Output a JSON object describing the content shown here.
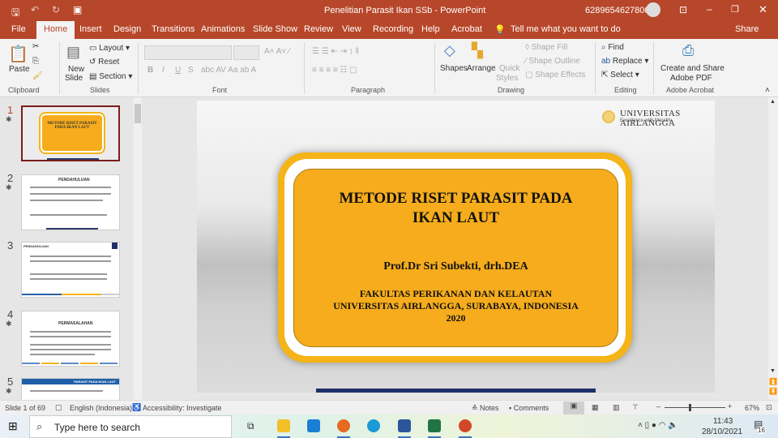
{
  "titlebar": {
    "title": "Penelitian Parasit Ikan SSb  -  PowerPoint",
    "account": "6289654627800"
  },
  "tabs": [
    "File",
    "Home",
    "Insert",
    "Design",
    "Transitions",
    "Animations",
    "Slide Show",
    "Review",
    "View",
    "Recording",
    "Help",
    "Acrobat"
  ],
  "tell_me": "Tell me what you want to do",
  "share": "Share",
  "ribbon": {
    "clipboard": {
      "paste": "Paste",
      "label": "Clipboard"
    },
    "slides": {
      "new_slide": "New",
      "new_slide2": "Slide",
      "layout": "Layout",
      "reset": "Reset",
      "section": "Section",
      "label": "Slides"
    },
    "font": {
      "label": "Font",
      "bold": "B",
      "italic": "I",
      "underline": "U",
      "strike": "S"
    },
    "paragraph": {
      "label": "Paragraph"
    },
    "drawing": {
      "shapes": "Shapes",
      "arrange": "Arrange",
      "quick": "Quick",
      "styles": "Styles",
      "fill": "Shape Fill",
      "outline": "Shape Outline",
      "effects": "Shape Effects",
      "label": "Drawing"
    },
    "editing": {
      "find": "Find",
      "replace": "Replace",
      "select": "Select",
      "label": "Editing"
    },
    "acrobat": {
      "create": "Create and Share",
      "pdf": "Adobe PDF",
      "label": "Adobe Acrobat"
    }
  },
  "thumbnails": [
    {
      "num": "1",
      "title": "METODE RISET PARASIT PADA IKAN LAUT"
    },
    {
      "num": "2",
      "title": "PENDAHULUAN"
    },
    {
      "num": "3",
      "title": "PENDAHULUAN"
    },
    {
      "num": "4",
      "title": "PERMASALAHAN"
    },
    {
      "num": "5",
      "title": "PARASIT PADA IKAN LAUT"
    }
  ],
  "slide": {
    "logo_name": "UNIVERSITAS AIRLANGGA",
    "logo_tagline": "Excellence with Morality",
    "title1": "METODE RISET PARASIT PADA",
    "title2": "IKAN LAUT",
    "author": "Prof.Dr Sri Subekti, drh.DEA",
    "inst1": "FAKULTAS PERIKANAN DAN KELAUTAN",
    "inst2": "UNIVERSITAS AIRLANGGA, SURABAYA, INDONESIA",
    "year": "2020"
  },
  "status": {
    "slide": "Slide 1 of 69",
    "lang": "English (Indonesia)",
    "access": "Accessibility: Investigate",
    "notes": "Notes",
    "comments": "Comments",
    "zoom": "67%"
  },
  "taskbar": {
    "search": "Type here to search",
    "time": "11:43",
    "date": "28/10/2021",
    "notif": "16"
  },
  "colors": {
    "accent": "#b7472a",
    "slide_orange": "#f6ac1c",
    "frame": "#f5b417"
  }
}
